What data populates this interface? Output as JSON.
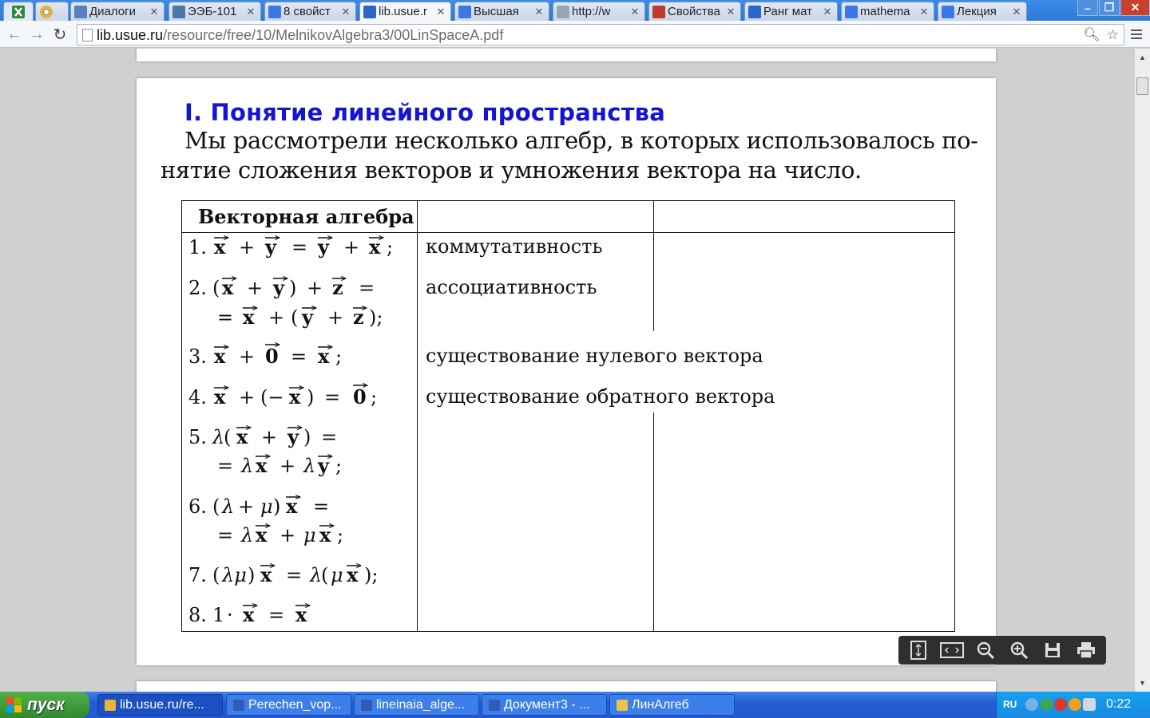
{
  "browser": {
    "tabs": [
      {
        "label": "Диалоги",
        "icon": "chat-icon",
        "color": "#5a7fc0"
      },
      {
        "label": "ЭЭБ-101",
        "icon": "vk-icon",
        "color": "#4a76a8"
      },
      {
        "label": "8 свойст",
        "icon": "google-icon",
        "color": "#3b78e7"
      },
      {
        "label": "lib.usue.r",
        "icon": "book-icon",
        "color": "#2d66c8"
      },
      {
        "label": "Высшая",
        "icon": "google-icon",
        "color": "#3b78e7"
      },
      {
        "label": "http://w",
        "icon": "page-icon",
        "color": "#9aa4b2"
      },
      {
        "label": "Свойства",
        "icon": "puzzle-icon",
        "color": "#c0392b"
      },
      {
        "label": "Ранг мат",
        "icon": "network-icon",
        "color": "#2d66c8"
      },
      {
        "label": "mathema",
        "icon": "google-icon",
        "color": "#3b78e7"
      },
      {
        "label": "Лекция",
        "icon": "google-icon",
        "color": "#3b78e7"
      }
    ],
    "url_host": "lib.usue.ru",
    "url_path": "/resource/free/10/MelnikovAlgebra3/00LinSpaceA.pdf"
  },
  "document": {
    "heading": "I. Понятие линейного пространства",
    "para_line1": "Мы рассмотрели несколько алгебр, в которых использовалось по-",
    "para_line2": "нятие сложения векторов и умножения вектора на число.",
    "table": {
      "header": "Векторная алгебра",
      "properties": [
        "коммутативность",
        "ассоциативность",
        "существование нулевого вектора",
        "существование обратного вектора"
      ]
    }
  },
  "taskbar": {
    "start_label": "пуск",
    "tasks": [
      {
        "label": "lib.usue.ru/re...",
        "color": "#e8b53a"
      },
      {
        "label": "Perechen_vop...",
        "color": "#2e5cb8"
      },
      {
        "label": "lineinaia_alge...",
        "color": "#2e5cb8"
      },
      {
        "label": "Документ3 - ...",
        "color": "#2e5cb8"
      },
      {
        "label": "ЛинАлгеб",
        "color": "#f0c24a"
      }
    ],
    "lang": "RU",
    "clock": "0:22"
  }
}
